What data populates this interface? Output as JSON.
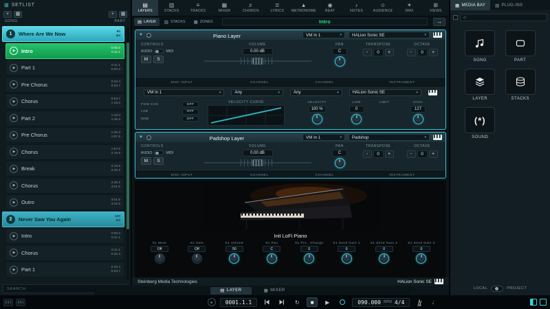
{
  "icons": {
    "grid": "⊞",
    "plus": "+",
    "panel": "▦",
    "play": "▶",
    "collapse": "▼",
    "dropdown": "▾",
    "arrow_right": "→",
    "home": "⌂",
    "loop": "↻",
    "stop": "■",
    "play_tr": "▶",
    "note": "♩"
  },
  "setlist": {
    "title": "SETLIST",
    "song_col": "SONG",
    "part_col": "PART",
    "search_placeholder": "SEARCH",
    "items": [
      {
        "num": "1",
        "label": "Where Are We Now",
        "meta1": "90",
        "meta2": "4/4"
      },
      {
        "label": "Intro",
        "meta1": "0:00.0",
        "meta2": "0:11.1"
      },
      {
        "label": "Part 1",
        "meta1": "0:11.1",
        "meta2": "0:32.4"
      },
      {
        "label": "Pre Chorus",
        "meta1": "0:32.4",
        "meta2": "0:53.7"
      },
      {
        "label": "Chorus",
        "meta1": "0:53.7",
        "meta2": "1:15.0"
      },
      {
        "label": "Part 2",
        "meta1": "1:15.0",
        "meta2": "1:36.3"
      },
      {
        "label": "Pre Chorus",
        "meta1": "1:36.3",
        "meta2": "1:57.6"
      },
      {
        "label": "Chorus",
        "meta1": "1:57.6",
        "meta2": "2:18.9"
      },
      {
        "label": "Break",
        "meta1": "2:18.9",
        "meta2": "2:40.2"
      },
      {
        "label": "Chorus",
        "meta1": "2:40.2",
        "meta2": "3:01.5"
      },
      {
        "label": "Outro",
        "meta1": "3:01.5",
        "meta2": "3:22.8"
      },
      {
        "num": "2",
        "label": "Never Saw You Again",
        "meta1": "120",
        "meta2": "4/4"
      },
      {
        "label": "Intro",
        "meta1": "0:00.0",
        "meta2": "0:11.1"
      },
      {
        "label": "Chorus",
        "meta1": "0:11.1",
        "meta2": "0:32.4"
      },
      {
        "label": "Part 1",
        "meta1": "0:32.4",
        "meta2": "0:53.7"
      }
    ]
  },
  "top_tabs": {
    "items": [
      {
        "label": "LAYERS",
        "glyph": "▤"
      },
      {
        "label": "STACKS",
        "glyph": "▥"
      },
      {
        "label": "TRACKS",
        "glyph": "≡"
      },
      {
        "label": "MIXER",
        "glyph": "▦"
      },
      {
        "label": "CHORDS",
        "glyph": "♬"
      },
      {
        "label": "LYRICS",
        "glyph": "≣"
      },
      {
        "label": "METRONOME",
        "glyph": "▲"
      },
      {
        "label": "BEAT",
        "glyph": "◉"
      },
      {
        "label": "NOTES",
        "glyph": "♪"
      },
      {
        "label": "AUDIENCE",
        "glyph": "☺"
      },
      {
        "label": "DMX",
        "glyph": "✶"
      },
      {
        "label": "VIEWS",
        "glyph": "⊞"
      }
    ]
  },
  "sub_tabs": {
    "items": [
      {
        "label": "LAYER",
        "glyph": "▤"
      },
      {
        "label": "STACKS",
        "glyph": "▥"
      },
      {
        "label": "ZONES",
        "glyph": "▦"
      }
    ],
    "current_part": "Intro"
  },
  "layers": [
    {
      "title": "Piano Layer",
      "midi_in": "VM In 1",
      "instrument": "HALion Sonic SE",
      "controls": "CONTROLS",
      "audio": "AUDIO",
      "midi": "MIDI",
      "mute": "M",
      "solo": "S",
      "volume_label": "VOLUME",
      "volume": "0.00 dB",
      "pan_label": "PAN",
      "pan": "C",
      "transpose_label": "TRANSPOSE",
      "transpose": "0",
      "octave_label": "OCTAVE",
      "octave": "0",
      "minus": "-",
      "plus": "+",
      "midi_input_label": "MIDI INPUT",
      "channel_label": "CHANNEL",
      "channel2_label": "CHANNEL",
      "instrument_label": "INSTRUMENT",
      "midi_input": "VM In 1",
      "channel": "Any",
      "channel2": "Any",
      "instrument_name": "HALion Sonic SE",
      "pgm_label": "PGM CHG",
      "pgm": "OFF",
      "lsb_label": "LSB",
      "lsb": "OFF",
      "msb_label": "MSB",
      "msb": "OFF",
      "curve_label": "VELOCITY CURVE",
      "velocity_label": "VELOCITY",
      "velocity": "100 %",
      "low_label": "LOW",
      "low": "0",
      "limit_label": "LIMIT",
      "high_label": "HIGH",
      "high": "127"
    },
    {
      "title": "Padshop Layer",
      "midi_in": "VM In 1",
      "instrument": "Padshop",
      "controls": "CONTROLS",
      "audio": "AUDIO",
      "midi": "MIDI",
      "mute": "M",
      "solo": "S",
      "volume_label": "VOLUME",
      "volume": "0.00 dB",
      "pan_label": "PAN",
      "pan": "C",
      "transpose_label": "TRANSPOSE",
      "transpose": "0",
      "octave_label": "OCTAVE",
      "octave": "0",
      "minus": "-",
      "plus": "+",
      "midi_input_label": "MIDI INPUT",
      "channel_label": "CHANNEL",
      "channel2_label": "CHANNEL",
      "instrument_label": "INSTRUMENT"
    }
  ],
  "editor": {
    "preset": "Init LoFi Piano",
    "vendor": "Steinberg Media Technologies",
    "plugin": "HALion Sonic SE",
    "params": [
      {
        "label": "S1 Mute",
        "value": "Off"
      },
      {
        "label": "S1 Solo",
        "value": "Off"
      },
      {
        "label": "S1 Volume",
        "value": "50"
      },
      {
        "label": "S1 Pan",
        "value": "C"
      },
      {
        "label": "S1 Pro...Change",
        "value": "0"
      },
      {
        "label": "S1 Send Gain 1",
        "value": "0"
      },
      {
        "label": "S1 Send Gain 2",
        "value": "0"
      },
      {
        "label": "S1 Send Gain 3",
        "value": "0"
      }
    ]
  },
  "footer": {
    "layer": "LAYER",
    "mixer": "MIXER",
    "layer_glyph": "▤",
    "mixer_glyph": "▦"
  },
  "transport": {
    "time": "0001.1.1",
    "bpm": "090.000",
    "bpm_unit": "BPM",
    "timesig": "4/4"
  },
  "media": {
    "tab_media": "MEDIA BAY",
    "tab_media_glyph": "▦",
    "tab_plugins": "PLUG-INS",
    "tab_plugins_glyph": "▧",
    "buttons": [
      {
        "label": "SONG"
      },
      {
        "label": "PART"
      },
      {
        "label": "LAYER"
      },
      {
        "label": "STACKS"
      },
      {
        "label": "SOUND"
      }
    ],
    "sound_glyph": "(*)",
    "local": "LOCAL",
    "project": "PROJECT"
  }
}
